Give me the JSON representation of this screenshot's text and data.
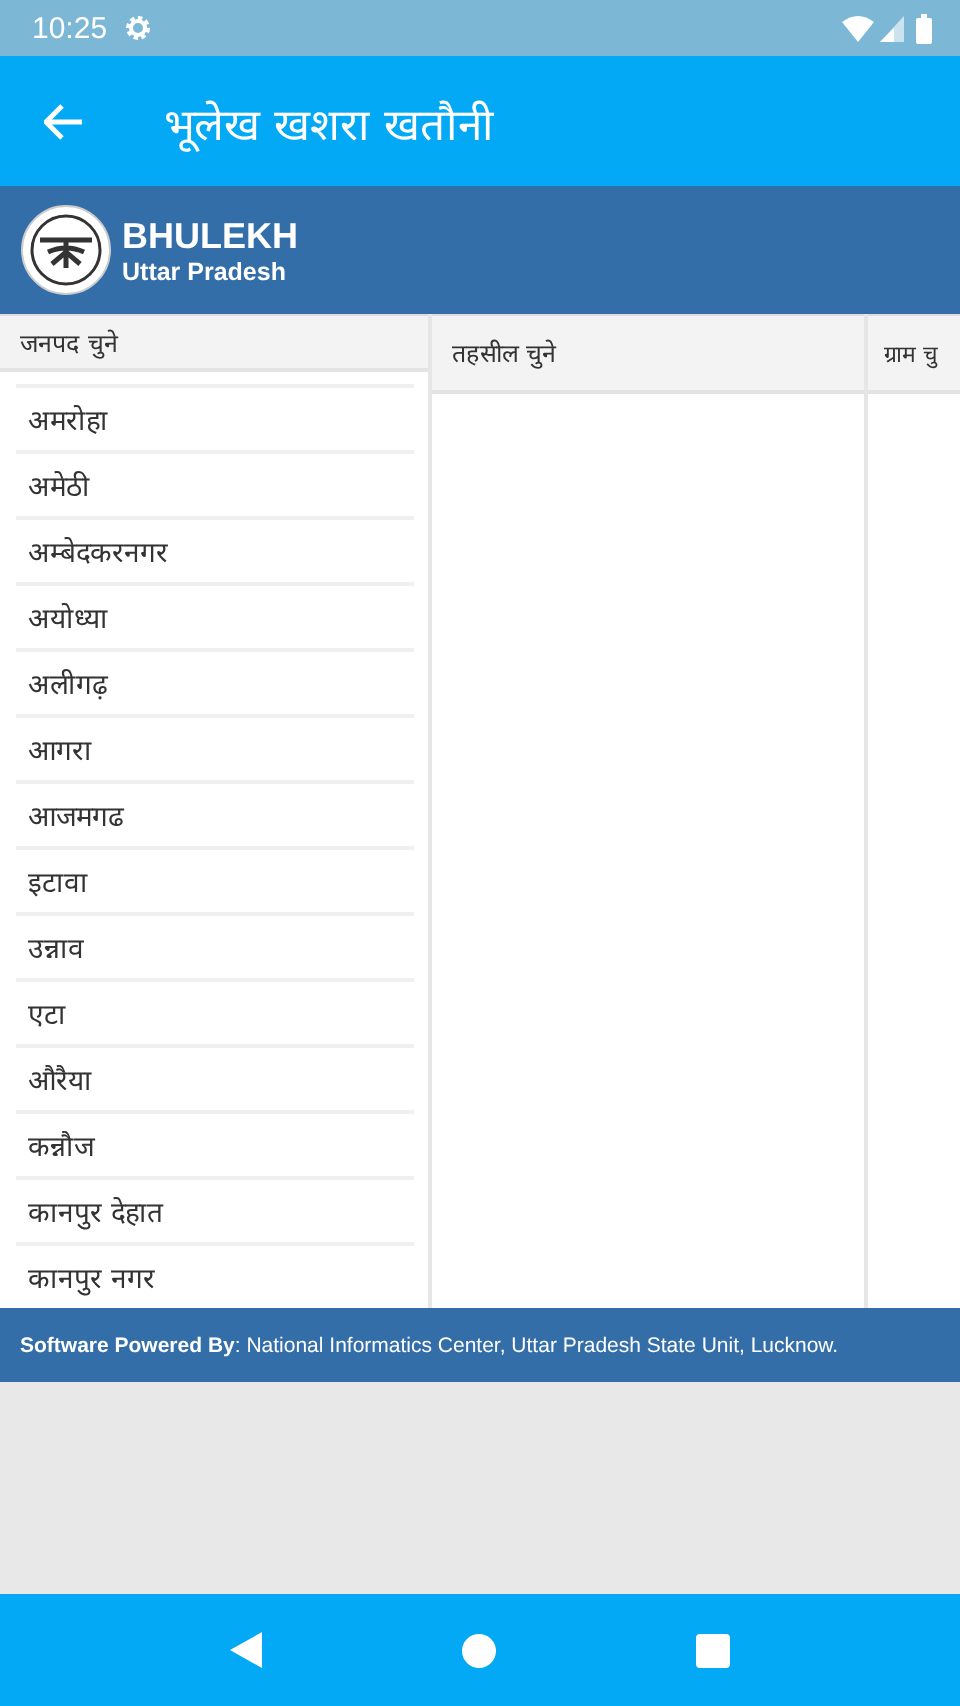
{
  "status_bar": {
    "time": "10:25"
  },
  "app_bar": {
    "title": "भूलेख खशरा खतौनी"
  },
  "header": {
    "title": "BHULEKH",
    "subtitle": "Uttar Pradesh"
  },
  "columns": [
    {
      "heading": "जनपद चुने",
      "items": [
        "अमरोहा",
        "अमेठी",
        "अम्बेदकरनगर",
        "अयोध्या",
        "अलीगढ़",
        "आगरा",
        "आजमगढ",
        "इटावा",
        "उन्नाव",
        "एटा",
        "औरैया",
        "कन्नौज",
        "कानपुर देहात",
        "कानपुर नगर"
      ]
    },
    {
      "heading": "तहसील चुने"
    },
    {
      "heading": "ग्राम चु"
    }
  ],
  "footer": {
    "text": "**Software Powered By**: National Informatics Center, Uttar Pradesh State Unit, Lucknow."
  }
}
